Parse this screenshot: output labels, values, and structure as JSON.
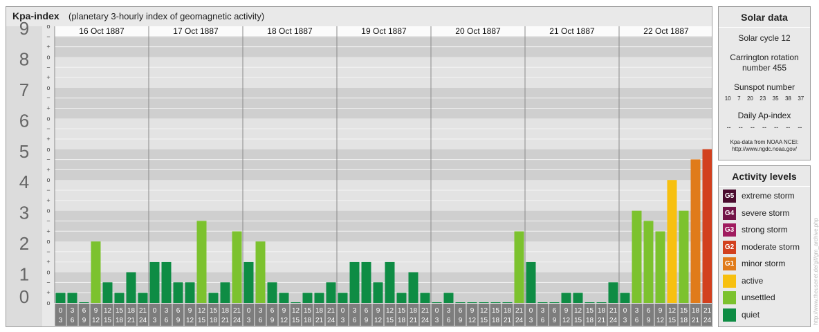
{
  "header": {
    "title": "Kpa-index",
    "subtitle": "(planetary 3-hourly index of geomagnetic activity)"
  },
  "solar": {
    "title": "Solar data",
    "cycle": "Solar cycle 12",
    "carrington_1": "Carrington rotation",
    "carrington_2": "number 455",
    "sunspot_title": "Sunspot number",
    "sunspot_values": [
      "10",
      "7",
      "20",
      "23",
      "35",
      "38",
      "37"
    ],
    "ap_title": "Daily Ap-index",
    "ap_values": [
      "--",
      "--",
      "--",
      "--",
      "--",
      "--",
      "--"
    ],
    "source_1": "Kpa-data from NOAA NCEI:",
    "source_2": "http://www.ngdc.noaa.gov/"
  },
  "activity": {
    "title": "Activity levels",
    "levels": [
      {
        "code": "G5",
        "label": "extreme storm",
        "color": "#4a0b2e"
      },
      {
        "code": "G4",
        "label": "severe storm",
        "color": "#731448"
      },
      {
        "code": "G3",
        "label": "strong storm",
        "color": "#a01c5f"
      },
      {
        "code": "G2",
        "label": "moderate storm",
        "color": "#d2401e"
      },
      {
        "code": "G1",
        "label": "minor storm",
        "color": "#e07b1a"
      },
      {
        "code": "",
        "label": "active",
        "color": "#f7c010"
      },
      {
        "code": "",
        "label": "unsettled",
        "color": "#7cc22e"
      },
      {
        "code": "",
        "label": "quiet",
        "color": "#0e8c44"
      }
    ]
  },
  "watermark": "http://www.theusenet.de/gif/gm_archive.php",
  "chart_data": {
    "type": "bar",
    "title": "Kpa-index",
    "ylim": [
      0,
      9
    ],
    "y_ticks": [
      "0",
      "1",
      "2",
      "3",
      "4",
      "5",
      "6",
      "7",
      "8",
      "9"
    ],
    "minor_ticks": [
      "o",
      "+",
      "−"
    ],
    "days": [
      "16 Oct 1887",
      "17 Oct 1887",
      "18 Oct 1887",
      "19 Oct 1887",
      "20 Oct 1887",
      "21 Oct 1887",
      "22 Oct 1887"
    ],
    "hour_starts": [
      "0",
      "3",
      "6",
      "9",
      "12",
      "15",
      "18",
      "21"
    ],
    "hour_ends": [
      "3",
      "6",
      "9",
      "12",
      "15",
      "18",
      "21",
      "24"
    ],
    "values": [
      0.33,
      0.33,
      0.0,
      2.0,
      0.67,
      0.33,
      1.0,
      0.33,
      1.33,
      1.33,
      0.67,
      0.67,
      2.67,
      0.33,
      0.67,
      2.33,
      1.33,
      2.0,
      0.67,
      0.33,
      0.0,
      0.33,
      0.33,
      0.67,
      0.33,
      1.33,
      1.33,
      0.67,
      1.33,
      0.33,
      1.0,
      0.33,
      0.0,
      0.33,
      0.0,
      0.0,
      0.0,
      0.0,
      0.0,
      2.33,
      1.33,
      0.0,
      0.0,
      0.33,
      0.33,
      0.0,
      0.0,
      0.67,
      0.33,
      3.0,
      2.67,
      2.33,
      4.0,
      3.0,
      4.67,
      5.0
    ],
    "colors": {
      "quiet": "#0e8c44",
      "unsettled": "#7cc22e",
      "active": "#f7c010",
      "g1": "#e07b1a",
      "g2": "#d2401e"
    }
  }
}
